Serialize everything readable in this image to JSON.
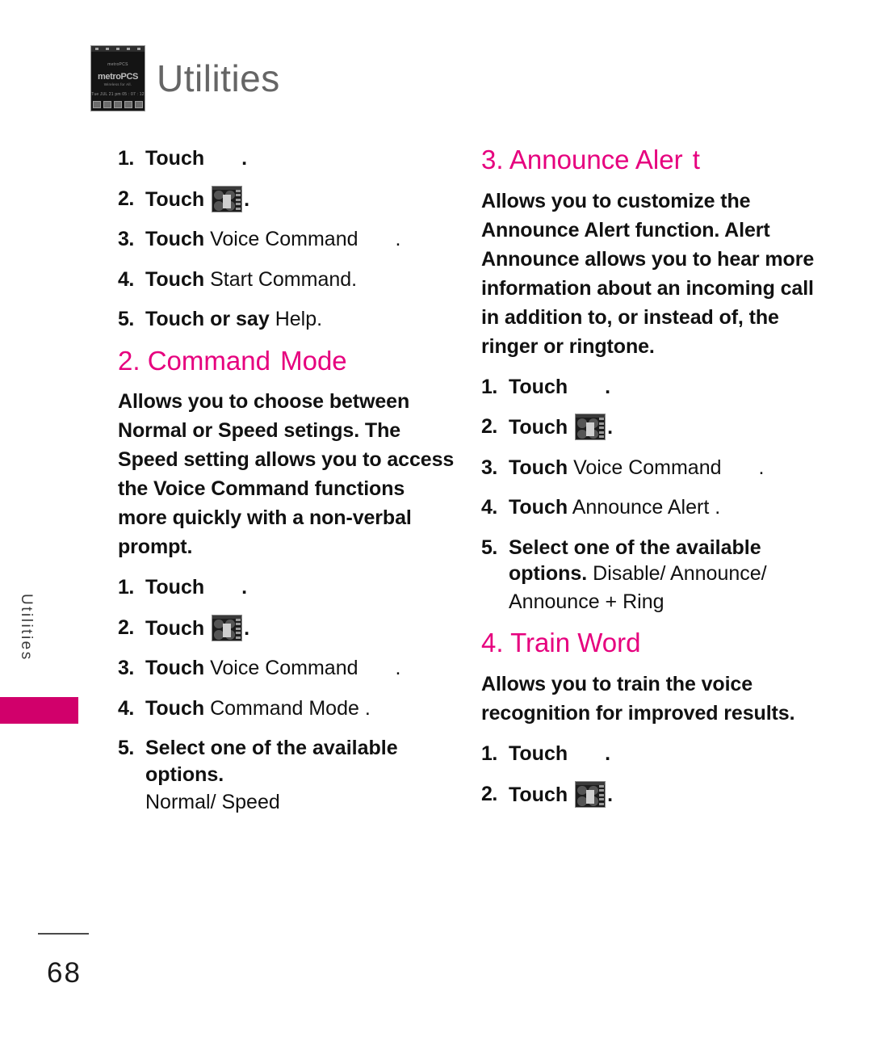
{
  "header": {
    "title": "Utilities",
    "phone_thumb": {
      "carrier": "metroPCS",
      "logo": "metroPCS",
      "logo_suffix": ".",
      "tagline": "Wireless for All.",
      "datetime": "Tue JUL 21 pm 05 : 07 : 12"
    }
  },
  "side_tab": {
    "label": "Utilities"
  },
  "footer": {
    "page_number": "68"
  },
  "icons": {
    "menu_screenshot": "menu-screenshot-icon",
    "phone_home_screen": "phone-home-screen-icon"
  },
  "left_column": {
    "continued_steps": [
      {
        "num": "1.",
        "verb": "Touch",
        "gap": true,
        "tail": "."
      },
      {
        "num": "2.",
        "verb": "Touch",
        "icon": "menu-screenshot-icon",
        "tail": "."
      },
      {
        "num": "3.",
        "verb": "Touch",
        "light": "Voice Command",
        "gap": true,
        "tail": "."
      },
      {
        "num": "4.",
        "verb": "Touch",
        "light": "Start Command."
      },
      {
        "num": "5.",
        "verb": "Touch or say",
        "light": "Help."
      }
    ],
    "section": {
      "heading_prefix": "2.",
      "heading_main": "Command",
      "heading_tail": "Mode",
      "body": "Allows you to choose between Normal or Speed setings. The Speed setting allows you to access the Voice Command functions more quickly with a non-verbal prompt.",
      "steps": [
        {
          "num": "1.",
          "verb": "Touch",
          "gap": true,
          "tail": "."
        },
        {
          "num": "2.",
          "verb": "Touch",
          "icon": "menu-screenshot-icon",
          "tail": "."
        },
        {
          "num": "3.",
          "verb": "Touch",
          "light": "Voice Command",
          "gap": true,
          "tail": "."
        },
        {
          "num": "4.",
          "verb": "Touch",
          "light": "Command Mode ."
        },
        {
          "num": "5.",
          "verb": "Select one of the available options.",
          "sub_light": "Normal/ Speed"
        }
      ]
    }
  },
  "right_column": {
    "section_announce": {
      "heading_prefix": "3.",
      "heading_main": "Announce Aler",
      "heading_tail": "t",
      "body": "Allows you to customize the Announce Alert function. Alert Announce allows you to hear more information about an incoming call in addition to, or instead of, the ringer or ringtone.",
      "steps": [
        {
          "num": "1.",
          "verb": "Touch",
          "gap": true,
          "tail": "."
        },
        {
          "num": "2.",
          "verb": "Touch",
          "icon": "menu-screenshot-icon",
          "tail": "."
        },
        {
          "num": "3.",
          "verb": "Touch",
          "light": "Voice Command",
          "gap": true,
          "tail": "."
        },
        {
          "num": "4.",
          "verb": "Touch",
          "light": "Announce Alert ."
        },
        {
          "num": "5.",
          "verb": "Select one of the available options.",
          "inline_light": "Disable/ Announce/",
          "sub_light": "Announce + Ring"
        }
      ]
    },
    "section_train": {
      "heading_prefix": "4.",
      "heading_main": "Train Word",
      "body": "Allows you to train the voice recognition for improved results.",
      "steps": [
        {
          "num": "1.",
          "verb": "Touch",
          "gap": true,
          "tail": "."
        },
        {
          "num": "2.",
          "verb": "Touch",
          "icon": "menu-screenshot-icon",
          "tail": "."
        }
      ]
    }
  }
}
